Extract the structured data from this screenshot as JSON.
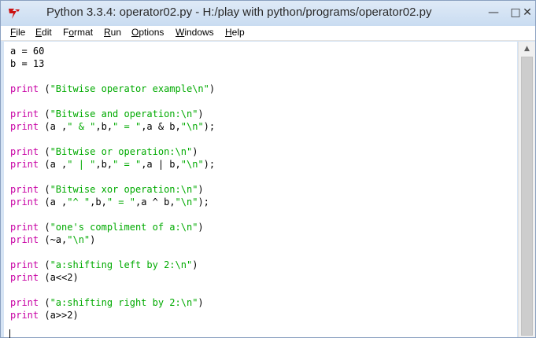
{
  "window": {
    "title": "Python 3.3.4: operator02.py - H:/play with python/programs/operator02.py",
    "minimize_glyph": "—",
    "maximize_glyph": "□",
    "close_glyph": "✕",
    "app_icon": "tk-feather-icon"
  },
  "menu": {
    "items": [
      {
        "key": "F",
        "rest": "ile"
      },
      {
        "key": "E",
        "rest": "dit"
      },
      {
        "key": "",
        "pre": "F",
        "key2": "o",
        "rest": "rmat"
      },
      {
        "key": "R",
        "rest": "un"
      },
      {
        "key": "O",
        "rest": "ptions"
      },
      {
        "key": "W",
        "rest": "indows"
      },
      {
        "key": "H",
        "rest": "elp"
      }
    ]
  },
  "code": {
    "lines": [
      {
        "parts": [
          {
            "t": "a = 60",
            "c": ""
          }
        ]
      },
      {
        "parts": [
          {
            "t": "b = 13",
            "c": ""
          }
        ]
      },
      {
        "parts": [
          {
            "t": "print",
            "c": "kw"
          },
          {
            "t": " (",
            "c": ""
          },
          {
            "t": "\"Bitwise operator example\\n\"",
            "c": "str"
          },
          {
            "t": ")",
            "c": ""
          }
        ]
      },
      {
        "parts": [
          {
            "t": "print",
            "c": "kw"
          },
          {
            "t": " (",
            "c": ""
          },
          {
            "t": "\"Bitwise and operation:\\n\"",
            "c": "str"
          },
          {
            "t": ")",
            "c": ""
          }
        ]
      },
      {
        "parts": [
          {
            "t": "print",
            "c": "kw"
          },
          {
            "t": " (a ,",
            "c": ""
          },
          {
            "t": "\" & \"",
            "c": "str"
          },
          {
            "t": ",b,",
            "c": ""
          },
          {
            "t": "\" = \"",
            "c": "str"
          },
          {
            "t": ",a & b,",
            "c": ""
          },
          {
            "t": "\"\\n\"",
            "c": "str"
          },
          {
            "t": ");",
            "c": ""
          }
        ]
      },
      {
        "parts": [
          {
            "t": "print",
            "c": "kw"
          },
          {
            "t": " (",
            "c": ""
          },
          {
            "t": "\"Bitwise or operation:\\n\"",
            "c": "str"
          },
          {
            "t": ")",
            "c": ""
          }
        ]
      },
      {
        "parts": [
          {
            "t": "print",
            "c": "kw"
          },
          {
            "t": " (a ,",
            "c": ""
          },
          {
            "t": "\" | \"",
            "c": "str"
          },
          {
            "t": ",b,",
            "c": ""
          },
          {
            "t": "\" = \"",
            "c": "str"
          },
          {
            "t": ",a | b,",
            "c": ""
          },
          {
            "t": "\"\\n\"",
            "c": "str"
          },
          {
            "t": ");",
            "c": ""
          }
        ]
      },
      {
        "parts": [
          {
            "t": "print",
            "c": "kw"
          },
          {
            "t": " (",
            "c": ""
          },
          {
            "t": "\"Bitwise xor operation:\\n\"",
            "c": "str"
          },
          {
            "t": ")",
            "c": ""
          }
        ]
      },
      {
        "parts": [
          {
            "t": "print",
            "c": "kw"
          },
          {
            "t": " (a ,",
            "c": ""
          },
          {
            "t": "\"^ \"",
            "c": "str"
          },
          {
            "t": ",b,",
            "c": ""
          },
          {
            "t": "\" = \"",
            "c": "str"
          },
          {
            "t": ",a ^ b,",
            "c": ""
          },
          {
            "t": "\"\\n\"",
            "c": "str"
          },
          {
            "t": ");",
            "c": ""
          }
        ]
      },
      {
        "parts": [
          {
            "t": "print",
            "c": "kw"
          },
          {
            "t": " (",
            "c": ""
          },
          {
            "t": "\"one's compliment of a:\\n\"",
            "c": "str"
          },
          {
            "t": ")",
            "c": ""
          }
        ]
      },
      {
        "parts": [
          {
            "t": "print",
            "c": "kw"
          },
          {
            "t": " (~a,",
            "c": ""
          },
          {
            "t": "\"\\n\"",
            "c": "str"
          },
          {
            "t": ")",
            "c": ""
          }
        ]
      },
      {
        "parts": [
          {
            "t": "print",
            "c": "kw"
          },
          {
            "t": " (",
            "c": ""
          },
          {
            "t": "\"a:shifting left by 2:\\n\"",
            "c": "str"
          },
          {
            "t": ")",
            "c": ""
          }
        ]
      },
      {
        "parts": [
          {
            "t": "print",
            "c": "kw"
          },
          {
            "t": " (a<<2)",
            "c": ""
          }
        ]
      },
      {
        "parts": [
          {
            "t": "print",
            "c": "kw"
          },
          {
            "t": " (",
            "c": ""
          },
          {
            "t": "\"a:shifting right by 2:\\n\"",
            "c": "str"
          },
          {
            "t": ")",
            "c": ""
          }
        ]
      },
      {
        "parts": [
          {
            "t": "print",
            "c": "kw"
          },
          {
            "t": " (a>>2)",
            "c": ""
          }
        ]
      }
    ]
  },
  "colors": {
    "keyword": "#c800a4",
    "string": "#00aa00",
    "text": "#000000"
  },
  "scrollbar": {
    "up_glyph": "▲"
  }
}
